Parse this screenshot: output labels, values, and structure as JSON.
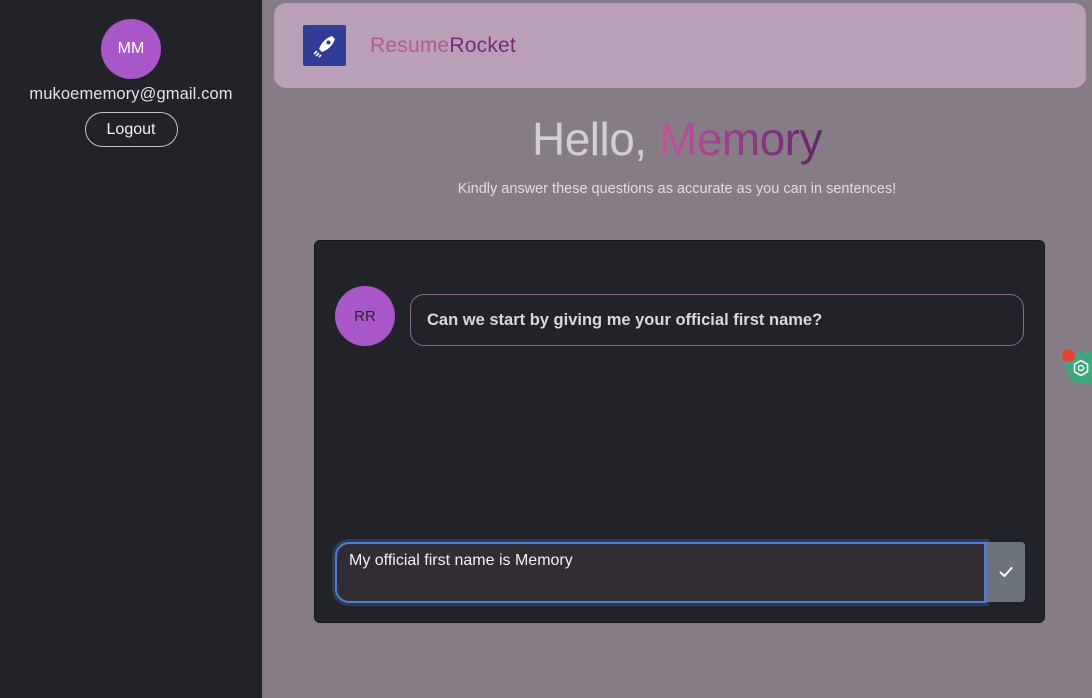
{
  "sidebar": {
    "avatar_initials": "MM",
    "email": "mukoememory@gmail.com",
    "logout_label": "Logout"
  },
  "header": {
    "brand_part1": "Resume",
    "brand_part2": "Rocket"
  },
  "greeting": {
    "hello": "Hello, ",
    "name": "Memory"
  },
  "subtitle": "Kindly answer these questions as accurate as you can in sentences!",
  "chat": {
    "bot_initials": "RR",
    "bot_question": "Can we start by giving me your official first name?",
    "answer_value": "My official first name is Memory"
  },
  "colors": {
    "accent": "#a957c8",
    "sidebar_bg": "#212329",
    "header_bg": "#b9a0b6",
    "focus_border": "#4e7fd8"
  },
  "icons": {
    "logo": "rocket-icon",
    "submit": "check-icon",
    "extension": "hexagon-icon"
  }
}
